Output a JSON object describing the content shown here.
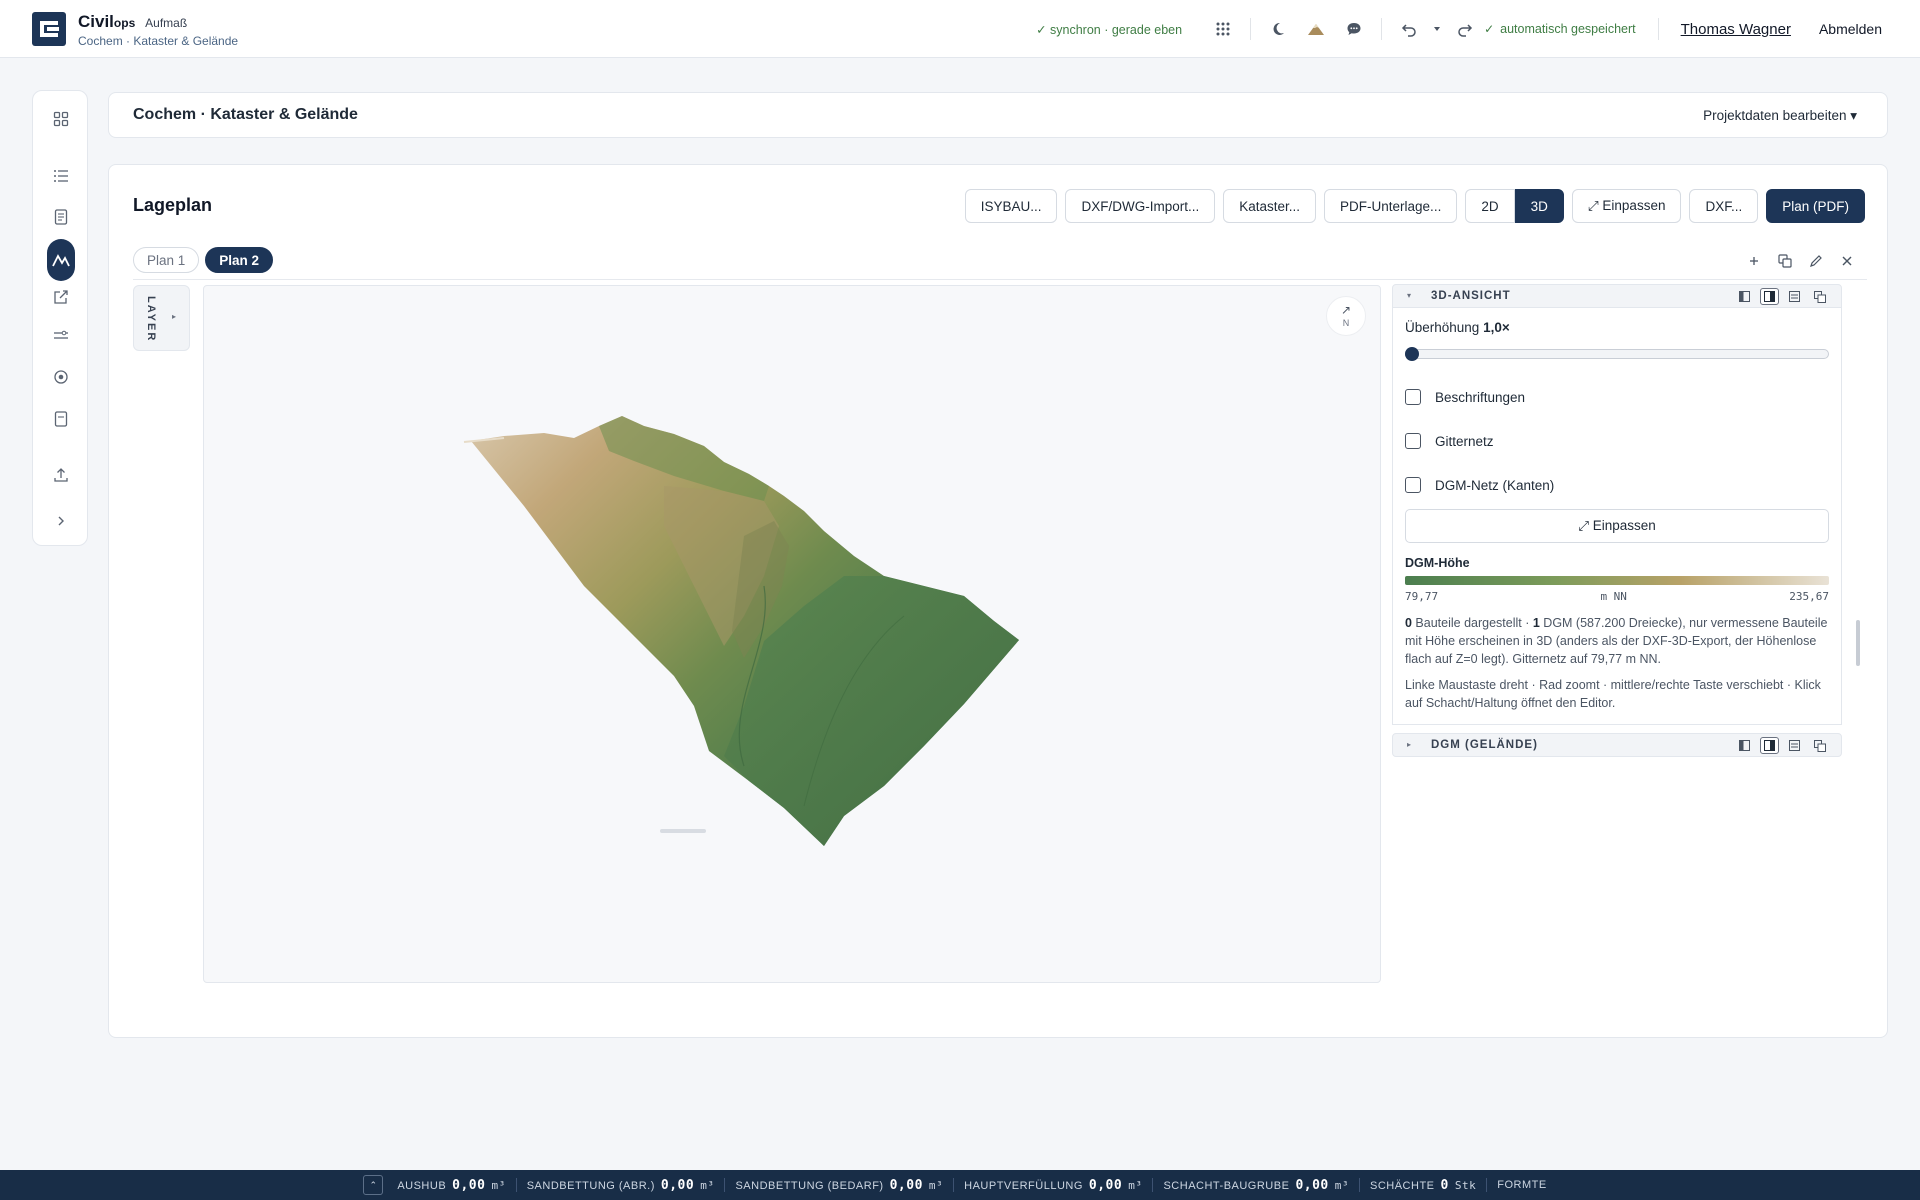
{
  "app": {
    "brand": "Civil",
    "brand_suffix": "ops",
    "module": "Aufmaß",
    "subtitle": "Cochem · Kataster & Gelände",
    "sync_status": "✓ synchron · gerade eben",
    "autosave": "automatisch gespeichert",
    "user": "Thomas Wagner",
    "logout": "Abmelden"
  },
  "project": {
    "title": "Cochem · Kataster & Gelände",
    "edit_menu": "Projektdaten bearbeiten ▾"
  },
  "lageplan": {
    "title": "Lageplan",
    "toolbar": {
      "isybau": "ISYBAU...",
      "dxf_import": "DXF/DWG-Import...",
      "kataster": "Kataster...",
      "pdf": "PDF-Unterlage...",
      "view_2d": "2D",
      "view_3d": "3D",
      "fit": "⤢ Einpassen",
      "dxf": "DXF...",
      "plan_pdf": "Plan (PDF)"
    },
    "tabs": [
      "Plan 1",
      "Plan 2"
    ],
    "active_tab": "Plan 2",
    "layer_label": "LAYER",
    "compass": "N"
  },
  "panel": {
    "view3d": {
      "title": "3D-ANSICHT",
      "exaggeration_label": "Überhöhung",
      "exaggeration_value": "1,0×",
      "exaggeration_fraction": 0.0,
      "checkboxes": [
        {
          "label": "Beschriftungen",
          "checked": false
        },
        {
          "label": "Gitternetz",
          "checked": false
        },
        {
          "label": "DGM-Netz (Kanten)",
          "checked": false
        }
      ],
      "fit_button": "⤢ Einpassen",
      "legend_title": "DGM-Höhe",
      "legend_min": "79,77",
      "legend_unit": "m NN",
      "legend_max": "235,67",
      "info_count_components": "0",
      "info_part1": " Bauteile dargestellt · ",
      "info_count_dgm": "1",
      "info_part2": " DGM (587.200 Dreiecke), nur vermessene Bauteile mit Höhe erscheinen in 3D (anders als der DXF-3D-Export, der Höhenlose flach auf Z=0 legt). Gitternetz auf 79,77 m NN.",
      "hint": "Linke Maustaste dreht · Rad zoomt · mittlere/rechte Taste verschiebt · Klick auf Schacht/Haltung öffnet den Editor."
    },
    "dgm": {
      "title": "DGM (GELÄNDE)"
    }
  },
  "statusbar": {
    "items": [
      {
        "label": "AUSHUB",
        "value": "0,00",
        "unit": "m³"
      },
      {
        "label": "SANDBETTUNG (ABR.)",
        "value": "0,00",
        "unit": "m³"
      },
      {
        "label": "SANDBETTUNG (BEDARF)",
        "value": "0,00",
        "unit": "m³"
      },
      {
        "label": "HAUPTVERFÜLLUNG",
        "value": "0,00",
        "unit": "m³"
      },
      {
        "label": "SCHACHT-BAUGRUBE",
        "value": "0,00",
        "unit": "m³"
      },
      {
        "label": "SCHÄCHTE",
        "value": "0",
        "unit": "Stk"
      },
      {
        "label": "FORMTE",
        "value": "",
        "unit": ""
      }
    ]
  },
  "colors": {
    "primary": "#1d3557",
    "terrain_low": "#4b7e4f",
    "terrain_high": "#e9e2d6",
    "ok_green": "#3f7d44"
  }
}
